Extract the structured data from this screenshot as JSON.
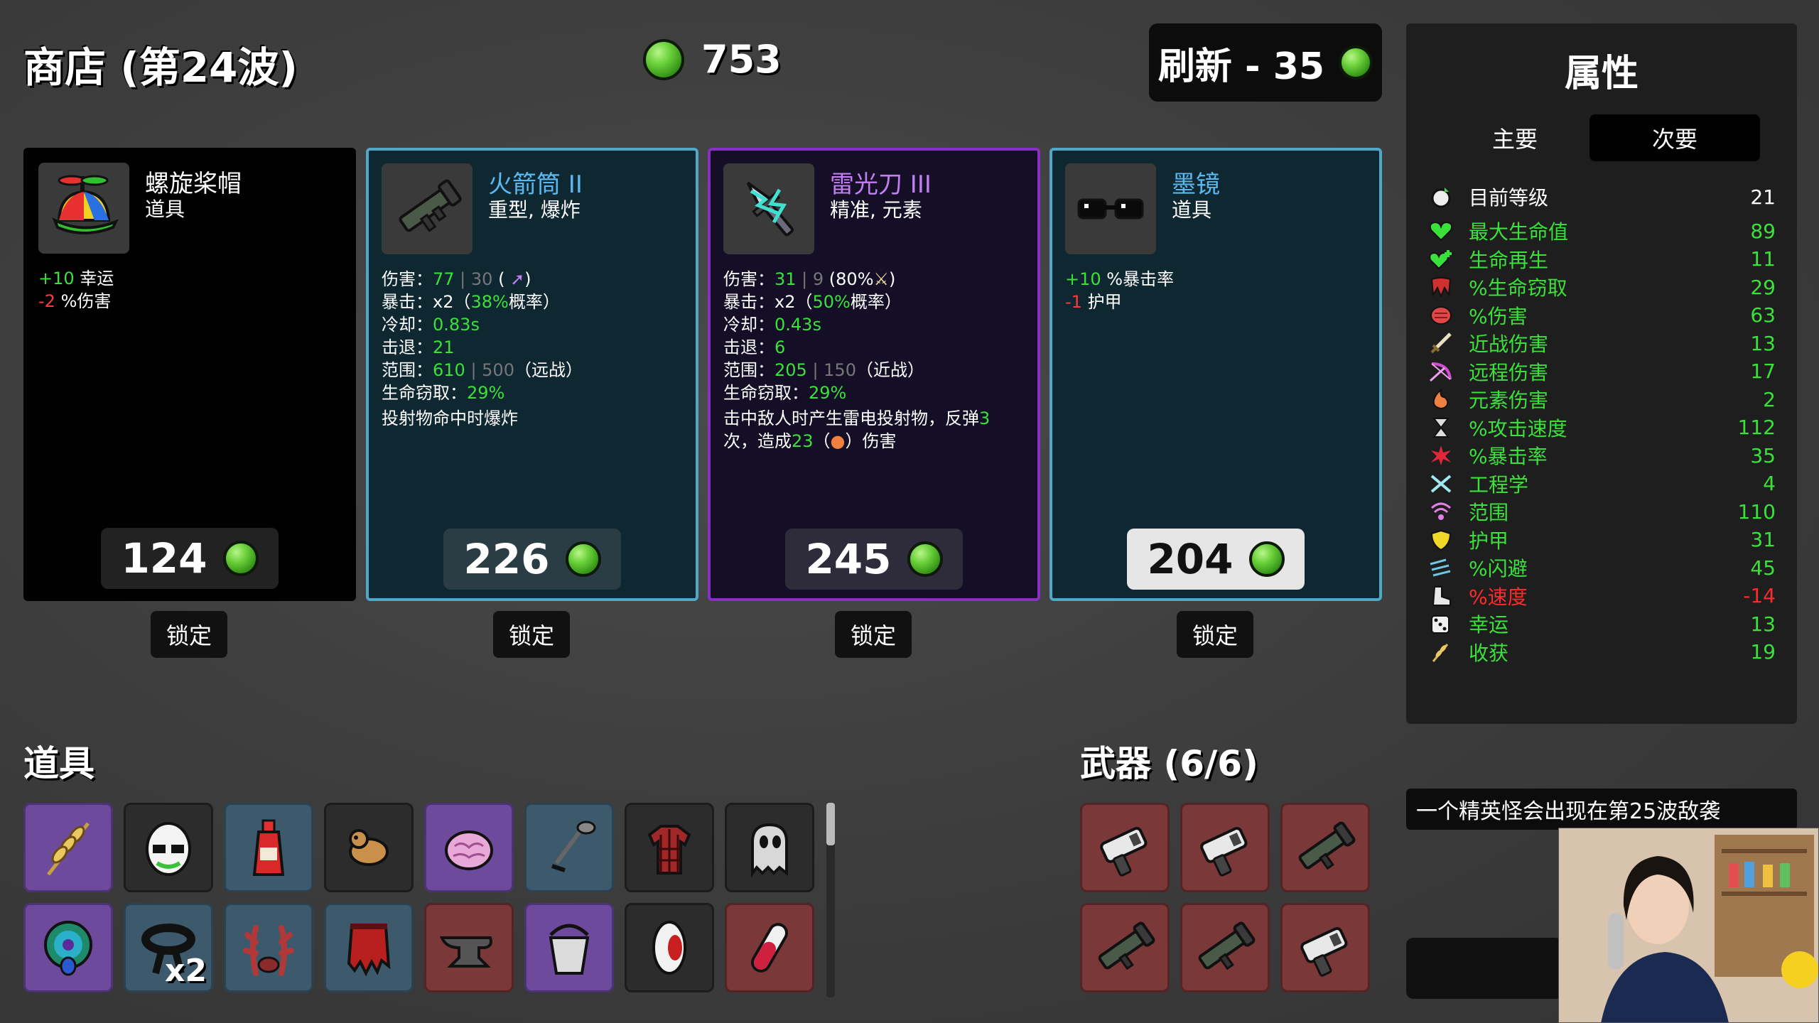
{
  "header": {
    "shop_title": "商店 (第24波)",
    "gold": "753",
    "refresh_label": "刷新 - 35"
  },
  "shop_cards": [
    {
      "name": "螺旋桨帽",
      "type": "道具",
      "price": "124",
      "lock_label": "锁定",
      "stats": [
        {
          "value": "+10",
          "label": "幸运",
          "color": "green"
        },
        {
          "value": "-2",
          "label": "%伤害",
          "color": "red"
        }
      ]
    },
    {
      "name": "火箭筒 II",
      "type": "重型, 爆炸",
      "price": "226",
      "lock_label": "锁定",
      "lines": [
        {
          "label": "伤害：",
          "v1": "77",
          "sep": " | ",
          "v2": "30",
          "tail": " ( ",
          "tail2": ")"
        },
        {
          "label": "暴击：",
          "v1": "x2",
          "mid": "（",
          "v2": "38%",
          "tail": "概率）"
        },
        {
          "label": "冷却：",
          "v1": "0.83s"
        },
        {
          "label": "击退：",
          "v1": "21"
        },
        {
          "label": "范围：",
          "v1": "610",
          "sep": " | ",
          "v2": "500",
          "tail": "（远战）"
        },
        {
          "label": "生命窃取：",
          "v1": "29%"
        }
      ],
      "effect": "投射物命中时爆炸"
    },
    {
      "name": "雷光刀 III",
      "type": "精准, 元素",
      "price": "245",
      "lock_label": "锁定",
      "lines": [
        {
          "label": "伤害：",
          "v1": "31",
          "sep": " | ",
          "v2": "9",
          "tail": " (80%",
          "tail2": ")"
        },
        {
          "label": "暴击：",
          "v1": "x2",
          "mid": "（",
          "v2": "50%",
          "tail": "概率）"
        },
        {
          "label": "冷却：",
          "v1": "0.43s"
        },
        {
          "label": "击退：",
          "v1": "6"
        },
        {
          "label": "范围：",
          "v1": "205",
          "sep": " | ",
          "v2": "150",
          "tail": "（近战）"
        },
        {
          "label": "生命窃取：",
          "v1": "29%"
        }
      ],
      "effect_a": "击中敌人时产生雷电投射物，反弹",
      "effect_a_num": "3",
      "effect_b1": "次，造成",
      "effect_b_num": "23",
      "effect_b2": "（",
      "effect_b3": "）伤害"
    },
    {
      "name": "墨镜",
      "type": "道具",
      "price": "204",
      "lock_label": "锁定",
      "stats": [
        {
          "value": "+10",
          "label": "%暴击率",
          "color": "green"
        },
        {
          "value": "-1",
          "label": "护甲",
          "color": "red"
        }
      ]
    }
  ],
  "items_section": {
    "title": "道具",
    "slots": [
      {
        "icon": "wheat-icon",
        "rarity": "purple"
      },
      {
        "icon": "egg-face-icon",
        "rarity": "dark"
      },
      {
        "icon": "ketchup-bottle-icon",
        "rarity": "blue"
      },
      {
        "icon": "weasel-icon",
        "rarity": "dark"
      },
      {
        "icon": "brain-icon",
        "rarity": "purple"
      },
      {
        "icon": "metal-detector-icon",
        "rarity": "blue"
      },
      {
        "icon": "plaid-shirt-icon",
        "rarity": "dark"
      },
      {
        "icon": "alien-ghost-icon",
        "rarity": "dark"
      },
      {
        "icon": "peacock-icon",
        "rarity": "purple"
      },
      {
        "icon": "black-belt-icon",
        "rarity": "blue",
        "count": "x2"
      },
      {
        "icon": "antlers-icon",
        "rarity": "blue"
      },
      {
        "icon": "torn-cape-icon",
        "rarity": "blue"
      },
      {
        "icon": "anvil-icon",
        "rarity": "red"
      },
      {
        "icon": "bucket-icon",
        "rarity": "purple"
      },
      {
        "icon": "eye-icon",
        "rarity": "dark"
      },
      {
        "icon": "potion-vial-icon",
        "rarity": "red"
      }
    ]
  },
  "weapons_section": {
    "title": "武器 (6/6)",
    "slots": [
      {
        "icon": "taser-icon"
      },
      {
        "icon": "taser-icon"
      },
      {
        "icon": "rocket-launcher-icon"
      },
      {
        "icon": "rocket-launcher-icon"
      },
      {
        "icon": "rocket-launcher-icon"
      },
      {
        "icon": "taser-icon"
      }
    ]
  },
  "attributes": {
    "title": "属性",
    "tab_main": "主要",
    "tab_secondary": "次要",
    "level_label": "目前等级",
    "level_value": "21",
    "stats": [
      {
        "label": "最大生命值",
        "value": "89",
        "color": "#3be03b",
        "icon": "heart-icon"
      },
      {
        "label": "生命再生",
        "value": "11",
        "color": "#3be03b",
        "icon": "heart-plus-icon"
      },
      {
        "label": "%生命窃取",
        "value": "29",
        "color": "#3be03b",
        "icon": "fangs-icon"
      },
      {
        "label": "%伤害",
        "value": "63",
        "color": "#3be03b",
        "icon": "fist-icon"
      },
      {
        "label": "近战伤害",
        "value": "13",
        "color": "#3be03b",
        "icon": "sword-icon"
      },
      {
        "label": "远程伤害",
        "value": "17",
        "color": "#3be03b",
        "icon": "bow-icon"
      },
      {
        "label": "元素伤害",
        "value": "2",
        "color": "#3be03b",
        "icon": "flame-icon"
      },
      {
        "label": "%攻击速度",
        "value": "112",
        "color": "#3be03b",
        "icon": "hourglass-icon"
      },
      {
        "label": "%暴击率",
        "value": "35",
        "color": "#3be03b",
        "icon": "crit-burst-icon"
      },
      {
        "label": "工程学",
        "value": "4",
        "color": "#3be03b",
        "icon": "wrench-cross-icon"
      },
      {
        "label": "范围",
        "value": "110",
        "color": "#3be03b",
        "icon": "range-icon"
      },
      {
        "label": "护甲",
        "value": "31",
        "color": "#3be03b",
        "icon": "shield-icon"
      },
      {
        "label": "%闪避",
        "value": "45",
        "color": "#3be03b",
        "icon": "dodge-icon"
      },
      {
        "label": "%速度",
        "value": "-14",
        "color": "#ff2a2a",
        "icon": "boot-icon"
      },
      {
        "label": "幸运",
        "value": "13",
        "color": "#3be03b",
        "icon": "dice-icon"
      },
      {
        "label": "收获",
        "value": "19",
        "color": "#3be03b",
        "icon": "harvest-icon"
      }
    ]
  },
  "wave_notice": "一个精英怪会出现在第25波敌袭"
}
